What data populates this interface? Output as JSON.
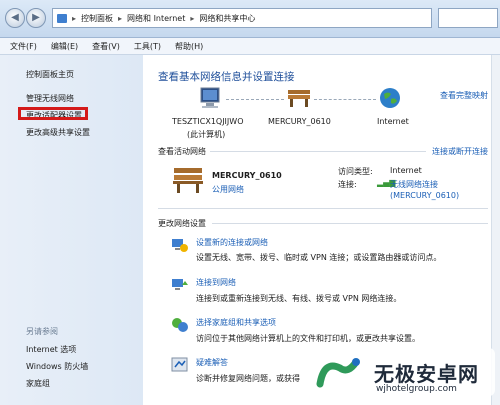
{
  "address_bar": {
    "crumbs": [
      "控制面板",
      "网络和 Internet",
      "网络和共享中心"
    ]
  },
  "menu": [
    "文件(F)",
    "编辑(E)",
    "查看(V)",
    "工具(T)",
    "帮助(H)"
  ],
  "sidebar": {
    "items": [
      "控制面板主页",
      "管理无线网络",
      "更改适配器设置",
      "更改高级共享设置"
    ],
    "see_also_title": "另请参阅",
    "see_also": [
      "Internet 选项",
      "Windows 防火墙",
      "家庭组"
    ]
  },
  "main": {
    "title": "查看基本网络信息并设置连接",
    "full_map_link": "查看完整映射",
    "map": {
      "computer_name": "TESZTICX1QJIJWO",
      "computer_sub": "(此计算机)",
      "router_name": "MERCURY_0610",
      "internet_name": "Internet"
    },
    "active_title": "查看活动网络",
    "connect_disconnect": "连接或断开连接",
    "network_name": "MERCURY_0610",
    "network_type": "公用网络",
    "access_type_label": "访问类型:",
    "access_type_value": "Internet",
    "connections_label": "连接:",
    "connection_value_1": "无线网络连接",
    "connection_value_2": "(MERCURY_0610)",
    "change_title": "更改网络设置",
    "tasks": [
      {
        "title": "设置新的连接或网络",
        "desc": "设置无线、宽带、拨号、临时或 VPN 连接；或设置路由器或访问点。"
      },
      {
        "title": "连接到网络",
        "desc": "连接到或重新连接到无线、有线、拨号或 VPN 网络连接。"
      },
      {
        "title": "选择家庭组和共享选项",
        "desc": "访问位于其他网络计算机上的文件和打印机，或更改共享设置。"
      },
      {
        "title": "疑难解答",
        "desc": "诊断并修复网络问题，或获得"
      }
    ]
  },
  "watermark": {
    "brand": "无极安卓网",
    "url": "wjhotelgroup.com"
  }
}
